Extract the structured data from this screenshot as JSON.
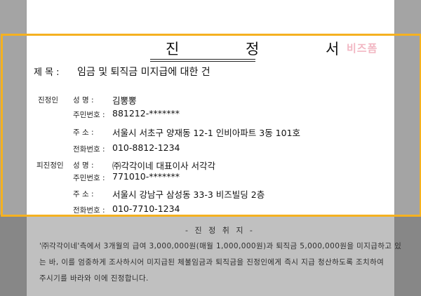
{
  "document": {
    "title": "진 정 서",
    "watermark": "비즈폼",
    "subject_label": "제  목 :",
    "subject": "임금 및 퇴직금 미지급에 대한 건"
  },
  "petitioner": {
    "section_label": "진정인",
    "name_label": "성    명 :",
    "name": "김뽕뽕",
    "id_label": "주민번호 :",
    "id": "881212-*******",
    "address_label": "주    소 :",
    "address": "서울시 서초구 양재동 12-1 인비아파트 3동 101호",
    "phone_label": "전화번호 :",
    "phone": "010-8812-1234"
  },
  "respondent": {
    "section_label": "피진정인",
    "name_label": "성    명 :",
    "name": "㈜각각이네 대표이사 서각각",
    "id_label": "주민번호 :",
    "id": "771010-*******",
    "address_label": "주    소 :",
    "address": "서울시 강남구 삼성동 33-3 비즈빌딩 2층",
    "phone_label": "전화번호 :",
    "phone": "010-7710-1234"
  },
  "purpose": {
    "heading": "- 진 정 취 지 -",
    "line1": "'㈜각각이네'측에서 3개월의 급여 3,000,000원(매월 1,000,000원)과 퇴직금 5,000,000원을 미지급하고 있",
    "line2": "는 바, 이를 엄중하게 조사하시어 미지급된 체불임금과 퇴직금을 진정인에게 즉시 지급 청산하도록 조치하여",
    "line3": "주시기를 바라와 이에 진정합니다."
  },
  "colors": {
    "highlight": "#f5b120",
    "watermark": "#f2b7c3",
    "background": "#a4a4a4"
  }
}
